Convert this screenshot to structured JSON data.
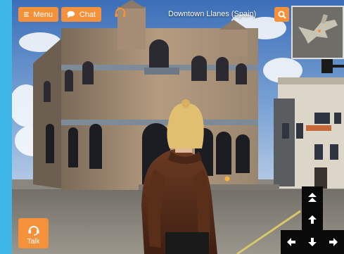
{
  "toolbar": {
    "menu_label": "Menu",
    "chat_label": "Chat"
  },
  "location": {
    "title": "Downtown Llanes (Spain)"
  },
  "talk": {
    "label": "Talk"
  },
  "colors": {
    "accent": "#f5913a",
    "frame": "#3fb6e8"
  },
  "icons": [
    "menu-icon",
    "chat-icon",
    "headset-icon",
    "search-icon",
    "microphone-icon",
    "up-double-arrow-icon",
    "up-arrow-icon",
    "down-arrow-icon",
    "left-arrow-icon",
    "right-arrow-icon"
  ]
}
